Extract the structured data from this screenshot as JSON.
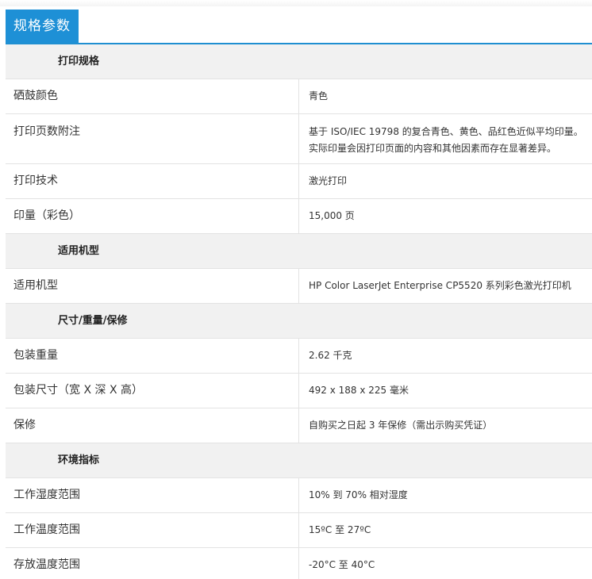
{
  "tab": {
    "label": "规格参数"
  },
  "sections": [
    {
      "title": "打印规格",
      "rows": [
        {
          "label": "硒鼓颜色",
          "value": [
            "青色"
          ]
        },
        {
          "label": "打印页数附注",
          "value": [
            "基于 ISO/IEC 19798 的复合青色、黄色、品红色近似平均印量。",
            "实际印量会因打印页面的内容和其他因素而存在显著差异。"
          ]
        },
        {
          "label": "打印技术",
          "value": [
            "激光打印"
          ]
        },
        {
          "label": "印量（彩色）",
          "value": [
            "15,000 页"
          ]
        }
      ]
    },
    {
      "title": "适用机型",
      "rows": [
        {
          "label": "适用机型",
          "value": [
            "HP Color LaserJet Enterprise CP5520 系列彩色激光打印机"
          ]
        }
      ]
    },
    {
      "title": "尺寸/重量/保修",
      "rows": [
        {
          "label": "包装重量",
          "value": [
            "2.62 千克"
          ]
        },
        {
          "label": "包装尺寸（宽 X 深 X 高）",
          "value": [
            "492 x 188 x 225 毫米"
          ]
        },
        {
          "label": "保修",
          "value": [
            "自购买之日起 3 年保修（需出示购买凭证）"
          ]
        }
      ]
    },
    {
      "title": "环境指标",
      "rows": [
        {
          "label": "工作湿度范围",
          "value": [
            "10% 到 70% 相对湿度"
          ]
        },
        {
          "label": "工作温度范围",
          "value": [
            "15ºC 至 27ºC"
          ]
        },
        {
          "label": "存放温度范围",
          "value": [
            "-20°C 至 40°C"
          ]
        }
      ]
    }
  ]
}
